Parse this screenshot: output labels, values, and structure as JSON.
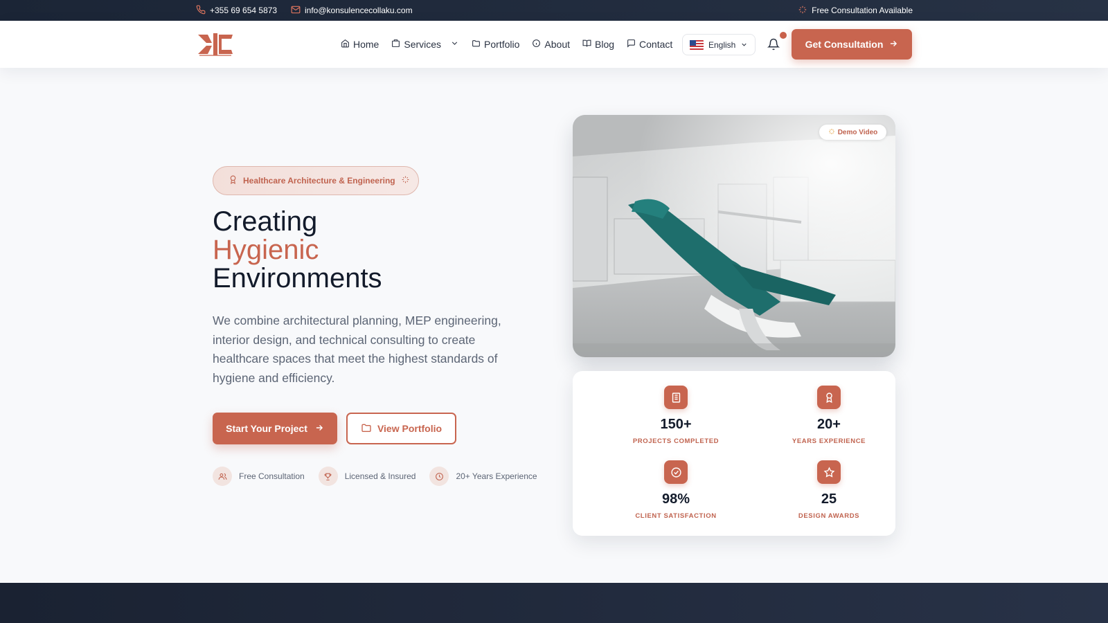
{
  "topbar": {
    "phone": "+355 69 654 5873",
    "email": "info@konsulencecollaku.com",
    "free_consultation": "Free Consultation Available"
  },
  "nav": {
    "items": [
      {
        "label": "Home",
        "icon": "home-icon"
      },
      {
        "label": "Services",
        "icon": "building-icon",
        "dropdown": true
      },
      {
        "label": "Portfolio",
        "icon": "folder-icon"
      },
      {
        "label": "About",
        "icon": "info-icon"
      },
      {
        "label": "Blog",
        "icon": "book-icon"
      },
      {
        "label": "Contact",
        "icon": "message-icon"
      }
    ],
    "language": "English",
    "cta": "Get Consultation"
  },
  "hero": {
    "badge": "Healthcare Architecture & Engineering",
    "headline_line1": "Creating",
    "headline_accent": "Hygienic",
    "headline_line3": "Environments",
    "lead": "We combine architectural planning, MEP engineering, interior design, and technical consulting to create healthcare spaces that meet the highest standards of hygiene and efficiency.",
    "primary_button": "Start Your Project",
    "secondary_button": "View Portfolio",
    "features": [
      "Free Consultation",
      "Licensed & Insured",
      "20+ Years Experience"
    ],
    "demo_label": "Demo Video"
  },
  "stats": [
    {
      "value": "150+",
      "label": "PROJECTS COMPLETED",
      "icon": "building-icon"
    },
    {
      "value": "20+",
      "label": "YEARS EXPERIENCE",
      "icon": "award-icon"
    },
    {
      "value": "98%",
      "label": "CLIENT SATISFACTION",
      "icon": "check-circle-icon"
    },
    {
      "value": "25",
      "label": "DESIGN AWARDS",
      "icon": "star-icon"
    }
  ],
  "colors": {
    "accent": "#c8654f",
    "dark": "#1b2536",
    "text": "#131b2b"
  }
}
